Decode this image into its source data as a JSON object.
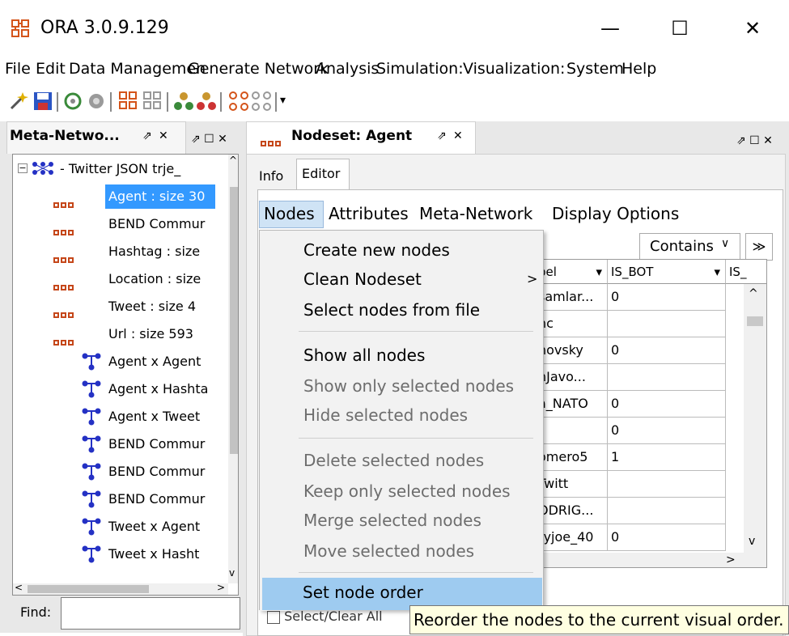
{
  "window": {
    "title": "ORA 3.0.9.129",
    "controls": {
      "minimize": "—",
      "maximize": "☐",
      "close": "✕"
    }
  },
  "menubar": {
    "items": [
      "File",
      "Edit",
      "Data Managemen",
      "Generate Network",
      "Analysis",
      "Simulation:",
      "Visualization:",
      "System",
      "Help"
    ]
  },
  "toolbar": {
    "icons": [
      "wand-icon",
      "save-icon",
      "network-gear-icon",
      "network-settings-icon",
      "nodeset-icon",
      "nodeset-grid-icon",
      "agents-icon",
      "agents-red-icon",
      "network-dots-icon",
      "network-dots-gray-icon",
      "dropdown-icon"
    ]
  },
  "left_panel": {
    "tab_label": "Meta-Netwo...",
    "tab_pin": "⇗",
    "tab_close": "✕",
    "panel_controls": "⇗ ☐ ✕",
    "tree_root": "Twitter JSON trje_",
    "tree_items": [
      {
        "type": "nodeset",
        "label": "Agent : size 30",
        "selected": true
      },
      {
        "type": "nodeset",
        "label": "BEND Commur"
      },
      {
        "type": "nodeset",
        "label": "Hashtag : size"
      },
      {
        "type": "nodeset",
        "label": "Location : size"
      },
      {
        "type": "nodeset",
        "label": "Tweet : size 4"
      },
      {
        "type": "nodeset",
        "label": "Url : size 593"
      },
      {
        "type": "network",
        "label": "Agent x Agent"
      },
      {
        "type": "network",
        "label": "Agent x Hashta"
      },
      {
        "type": "network",
        "label": "Agent x Tweet"
      },
      {
        "type": "network",
        "label": "BEND Commur"
      },
      {
        "type": "network",
        "label": "BEND Commur"
      },
      {
        "type": "network",
        "label": "BEND Commur"
      },
      {
        "type": "network",
        "label": "Tweet x Agent"
      },
      {
        "type": "network",
        "label": "Tweet x Hasht"
      }
    ],
    "find_label": "Find:",
    "find_value": ""
  },
  "right_panel": {
    "tab_label": "Nodeset: Agent",
    "tab_pin": "⇗",
    "tab_close": "✕",
    "panel_controls": "⇗ ☐ ✕",
    "subtabs": [
      "Info",
      "Editor"
    ],
    "active_subtab": "Editor",
    "editor_menu": [
      "Nodes",
      "Attributes",
      "Meta-Network",
      "Display Options"
    ],
    "filter": {
      "mode": "Contains",
      "expand": "≫"
    },
    "table": {
      "headers": [
        "bel",
        "IS_BOT",
        "IS_"
      ],
      "rows": [
        [
          "samlar...",
          "0"
        ],
        [
          "nc",
          ""
        ],
        [
          "hovsky",
          "0"
        ],
        [
          "nJavo...",
          ""
        ],
        [
          "a_NATO",
          "0"
        ],
        [
          "",
          "0"
        ],
        [
          "omero5",
          "1"
        ],
        [
          "Twitt",
          ""
        ],
        [
          "ODRIG...",
          ""
        ],
        [
          "ryjoe_40",
          "0"
        ]
      ]
    },
    "select_clear": "Select/Clear All"
  },
  "dropdown_menu": {
    "groups": [
      [
        {
          "label": "Create new nodes",
          "enabled": true
        },
        {
          "label": "Clean Nodeset",
          "enabled": true,
          "submenu": true
        },
        {
          "label": "Select nodes from file",
          "enabled": true
        }
      ],
      [
        {
          "label": "Show all nodes",
          "enabled": true
        },
        {
          "label": "Show only selected nodes",
          "enabled": false
        },
        {
          "label": "Hide selected nodes",
          "enabled": false
        }
      ],
      [
        {
          "label": "Delete selected nodes",
          "enabled": false
        },
        {
          "label": "Keep only selected nodes",
          "enabled": false
        },
        {
          "label": "Merge selected nodes",
          "enabled": false
        },
        {
          "label": "Move selected nodes",
          "enabled": false
        }
      ],
      [
        {
          "label": "Set node order",
          "enabled": true,
          "highlighted": true
        }
      ]
    ],
    "submenu_arrow": ">"
  },
  "tooltip": {
    "text": "Reorder the nodes to the current visual order."
  },
  "colors": {
    "selection": "#3399ff",
    "menu_highlight": "#9ecbf0",
    "tooltip_bg": "#ffffe1",
    "nodeset_icon": "#c5471a",
    "network_icon": "#2431c4"
  }
}
